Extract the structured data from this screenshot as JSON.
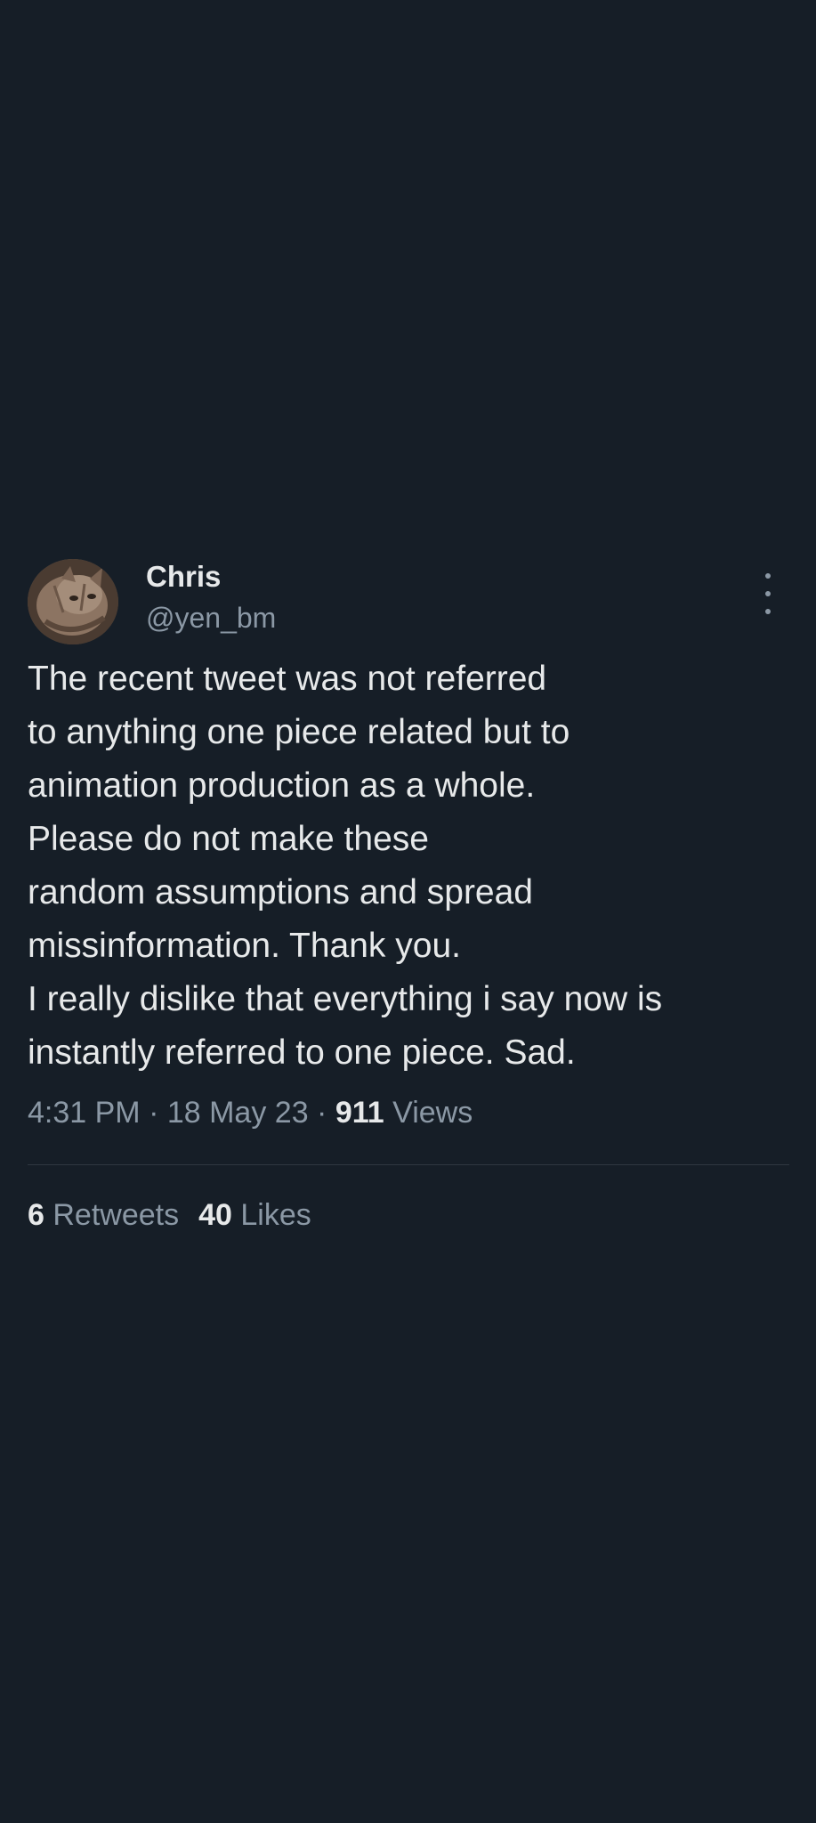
{
  "tweet": {
    "author": {
      "name": "Chris",
      "handle": "@yen_bm",
      "avatar_icon": "cat-avatar"
    },
    "more_icon": "vertical-ellipsis-icon",
    "text": "The recent tweet was not referred\nto anything one piece related but to\nanimation production as a whole.\nPlease do not make these\nrandom assumptions and spread\nmissinformation. Thank you.\nI really dislike that everything i say now is\ninstantly referred to one piece. Sad.",
    "time": "4:31 PM",
    "date": "18 May 23",
    "separator": " · ",
    "views_count": "911",
    "views_label": " Views",
    "retweets_count": "6",
    "retweets_label": " Retweets",
    "likes_count": "40",
    "likes_label": " Likes"
  },
  "colors": {
    "background": "#161e27",
    "primary_text": "#e7e9ea",
    "secondary_text": "#8b98a5",
    "divider": "#2f3740"
  }
}
